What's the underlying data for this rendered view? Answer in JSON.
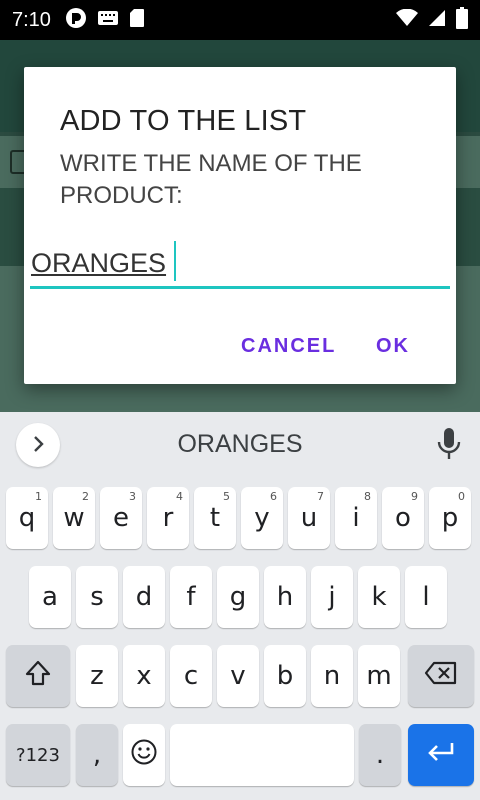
{
  "status_bar": {
    "time": "7:10"
  },
  "dialog": {
    "title": "ADD TO THE LIST",
    "message": "WRITE THE NAME OF THE PRODUCT:",
    "input_value": "ORANGES",
    "cancel_label": "CANCEL",
    "ok_label": "OK"
  },
  "keyboard": {
    "suggestion": "ORANGES",
    "row1": [
      {
        "char": "q",
        "hint": "1"
      },
      {
        "char": "w",
        "hint": "2"
      },
      {
        "char": "e",
        "hint": "3"
      },
      {
        "char": "r",
        "hint": "4"
      },
      {
        "char": "t",
        "hint": "5"
      },
      {
        "char": "y",
        "hint": "6"
      },
      {
        "char": "u",
        "hint": "7"
      },
      {
        "char": "i",
        "hint": "8"
      },
      {
        "char": "o",
        "hint": "9"
      },
      {
        "char": "p",
        "hint": "0"
      }
    ],
    "row2": [
      "a",
      "s",
      "d",
      "f",
      "g",
      "h",
      "j",
      "k",
      "l"
    ],
    "row3": [
      "z",
      "x",
      "c",
      "v",
      "b",
      "n",
      "m"
    ],
    "symbols_label": "?123",
    "comma_label": ",",
    "period_label": "."
  },
  "icons": {
    "status": [
      "pocket-casts-icon",
      "keyboard-icon",
      "sd-card-icon",
      "wifi-icon",
      "signal-icon",
      "battery-icon"
    ],
    "keyboard": [
      "chevron-right-icon",
      "mic-icon",
      "shift-icon",
      "backspace-icon",
      "emoji-icon",
      "enter-icon"
    ]
  },
  "colors": {
    "accent": "#1ec5c0",
    "button_text": "#6a2ee0",
    "enter_key": "#1a73e8"
  }
}
